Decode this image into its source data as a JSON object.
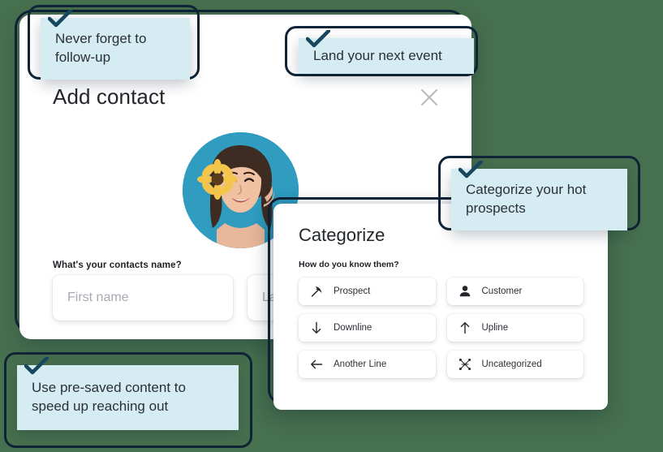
{
  "theme": {
    "background": "#47704e",
    "outline": "#102437",
    "callout_bg": "#d6ecf3",
    "avatar_bg": "#2f9cc0",
    "text": "#2b3036"
  },
  "add_contact": {
    "title": "Add contact",
    "close_icon": "close-icon",
    "avatar_alt": "contact-avatar-illustration",
    "name_label": "What's your contacts name?",
    "first_name": {
      "value": "",
      "placeholder": "First name"
    },
    "last_name": {
      "value": "",
      "placeholder": "Last name"
    }
  },
  "categorize": {
    "title": "Categorize",
    "subtitle": "How do you know them?",
    "options": [
      {
        "label": "Prospect",
        "icon": "pickaxe-icon"
      },
      {
        "label": "Customer",
        "icon": "person-icon"
      },
      {
        "label": "Downline",
        "icon": "arrow-down-icon"
      },
      {
        "label": "Upline",
        "icon": "arrow-up-icon"
      },
      {
        "label": "Another Line",
        "icon": "arrow-left-icon"
      },
      {
        "label": "Uncategorized",
        "icon": "network-scatter-icon"
      }
    ]
  },
  "callouts": [
    {
      "text": "Never forget to follow-up",
      "icon": "checkmark-icon"
    },
    {
      "text": "Land your next event",
      "icon": "checkmark-icon"
    },
    {
      "text": "Categorize your hot prospects",
      "icon": "checkmark-icon"
    },
    {
      "text": "Use pre-saved content to speed up reaching out",
      "icon": "checkmark-icon"
    }
  ]
}
